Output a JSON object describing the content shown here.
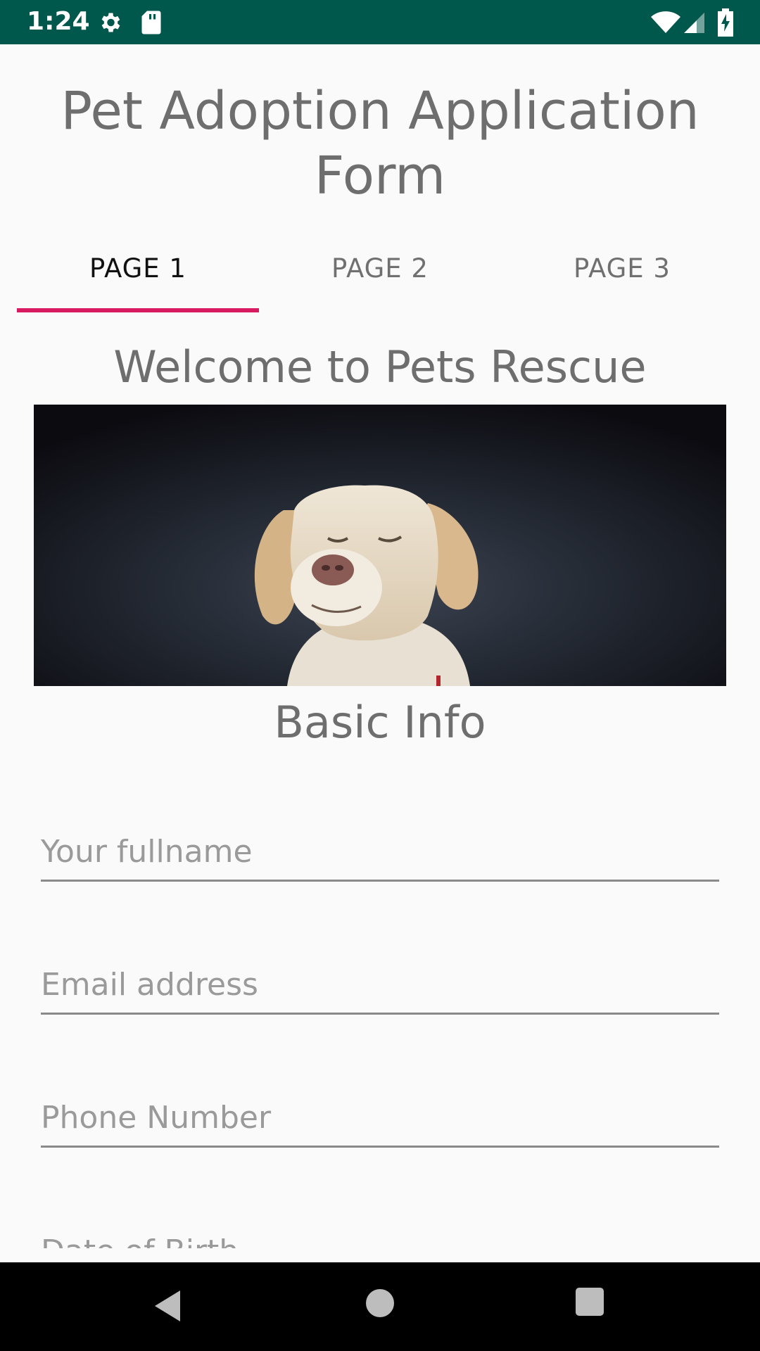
{
  "status_bar": {
    "time": "1:24",
    "icons": [
      "gear-icon",
      "sd-card-icon",
      "wifi-icon",
      "signal-icon",
      "battery-charging-icon"
    ]
  },
  "app": {
    "title": "Pet Adoption Application Form",
    "tabs": [
      {
        "label": "PAGE 1",
        "active": true
      },
      {
        "label": "PAGE 2",
        "active": false
      },
      {
        "label": "PAGE 3",
        "active": false
      }
    ],
    "accent_color": "#d81b60",
    "status_bar_color": "#00574b",
    "welcome": "Welcome to Pets Rescue",
    "section_title": "Basic Info",
    "fields": [
      {
        "placeholder": "Your fullname",
        "value": ""
      },
      {
        "placeholder": "Email address",
        "value": ""
      },
      {
        "placeholder": "Phone Number",
        "value": ""
      },
      {
        "placeholder": "Date of Birth",
        "value": ""
      }
    ]
  },
  "nav_bar": {
    "icons": [
      "back-icon",
      "home-icon",
      "recent-apps-icon"
    ]
  }
}
